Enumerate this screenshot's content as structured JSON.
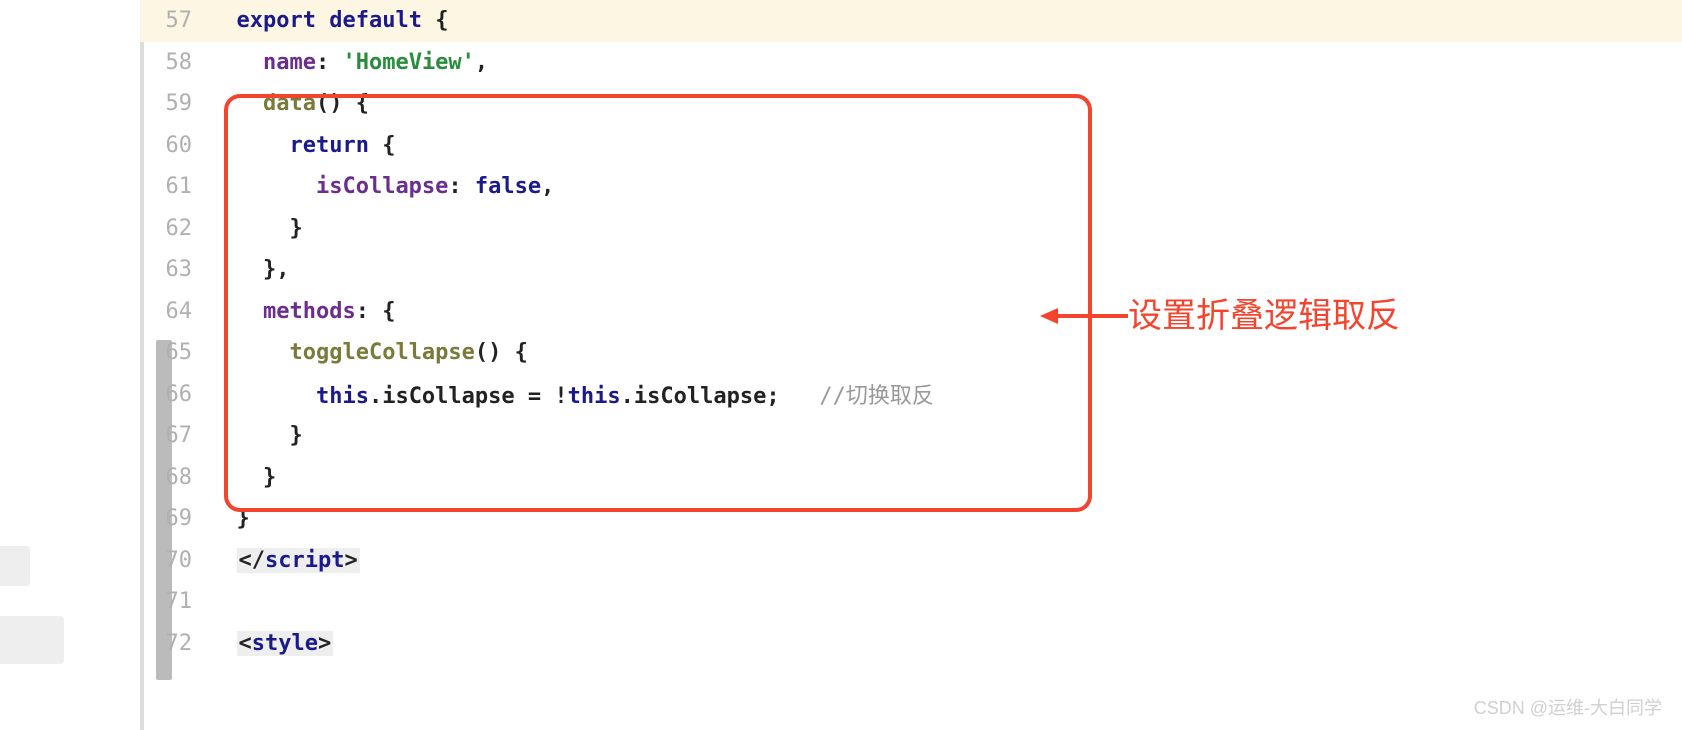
{
  "lines": {
    "l57_num": "57",
    "l57_export": "export",
    "l57_default": "default",
    "l57_brace": " {",
    "l58_num": "58",
    "l58_name": "name",
    "l58_colon": ": ",
    "l58_str": "'HomeView'",
    "l58_comma": ",",
    "l59_num": "59",
    "l59_data": "data",
    "l59_paren": "() {",
    "l60_num": "60",
    "l60_return": "return",
    "l60_brace": " {",
    "l61_num": "61",
    "l61_prop": "isCollapse",
    "l61_colon": ": ",
    "l61_bool": "false",
    "l61_comma": ",",
    "l62_num": "62",
    "l62_brace": "}",
    "l63_num": "63",
    "l63_brace": "},",
    "l64_num": "64",
    "l64_methods": "methods",
    "l64_rest": ": {",
    "l65_num": "65",
    "l65_fn": "toggleCollapse",
    "l65_rest": "() {",
    "l66_num": "66",
    "l66_this1": "this",
    "l66_dot1": ".isCollapse = !",
    "l66_this2": "this",
    "l66_dot2": ".isCollapse;",
    "l66_comment": "//切换取反",
    "l67_num": "67",
    "l67_brace": "}",
    "l68_num": "68",
    "l68_brace": "}",
    "l69_num": "69",
    "l69_brace": "}",
    "l70_num": "70",
    "l70_tag_open": "</",
    "l70_tag_name": "script",
    "l70_tag_close": ">",
    "l71_num": "71",
    "l72_num": "72",
    "l72_tag_open": "<",
    "l72_tag_name": "style",
    "l72_tag_close": ">"
  },
  "annotation": "设置折叠逻辑取反",
  "watermark": "CSDN @运维-大白同学"
}
